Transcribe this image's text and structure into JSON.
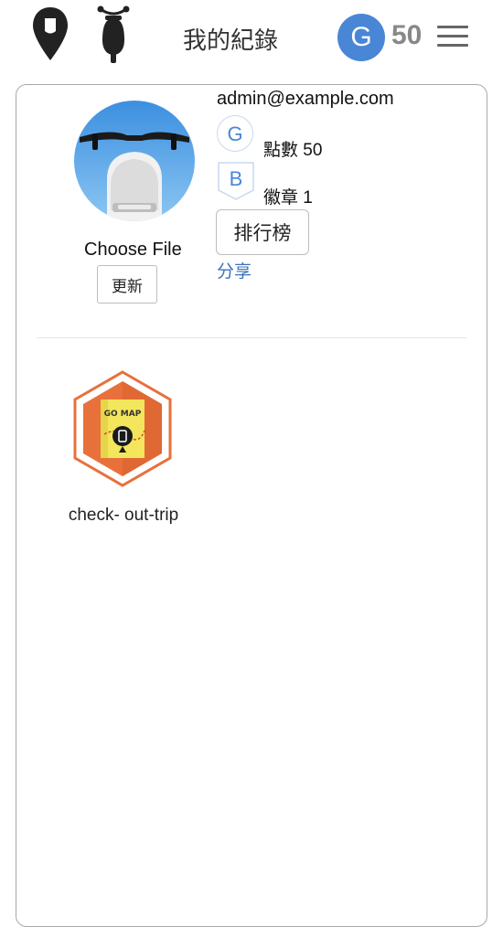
{
  "header": {
    "title": "我的紀錄",
    "points_badge_letter": "G",
    "points_value": "50",
    "icons": [
      "location-pin-icon",
      "scooter-icon",
      "hamburger-menu-icon"
    ]
  },
  "profile": {
    "choose_file_label": "Choose File",
    "update_button": "更新",
    "email": "admin@example.com",
    "points_icon_letter": "G",
    "points_label": "點數 50",
    "badges_icon_letter": "B",
    "badges_label": "徽章 1",
    "ranking_button": "排行榜",
    "share_link": "分享"
  },
  "badges": [
    {
      "name": "check-out-trip",
      "display": "check- out-trip",
      "image_text": "GO MAP"
    }
  ],
  "colors": {
    "accent_blue": "#4a86d6",
    "link_blue": "#3b73b9",
    "badge_orange": "#e8703a",
    "map_yellow": "#f3e65c"
  }
}
